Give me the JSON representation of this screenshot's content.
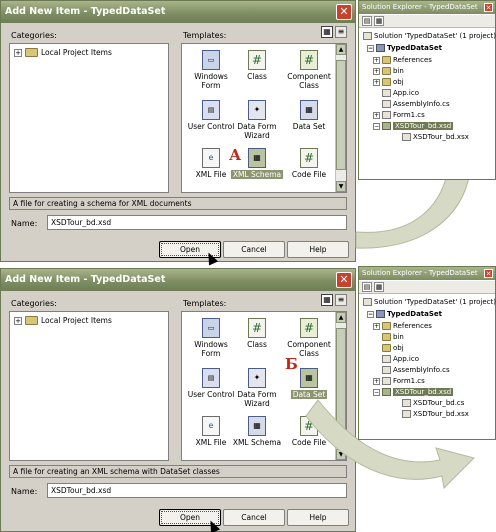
{
  "dialogs": [
    {
      "title": "Add New Item - TypedDataSet",
      "categories_label": "Categories:",
      "templates_label": "Templates:",
      "category_item": "Local Project Items",
      "templates": [
        {
          "label": "Windows Form",
          "icon": "windows-form-icon"
        },
        {
          "label": "Class",
          "icon": "class-icon"
        },
        {
          "label": "Component Class",
          "icon": "component-class-icon"
        },
        {
          "label": "User Control",
          "icon": "user-control-icon"
        },
        {
          "label": "Data Form Wizard",
          "icon": "data-form-wizard-icon"
        },
        {
          "label": "Data Set",
          "icon": "data-set-icon"
        },
        {
          "label": "XML File",
          "icon": "xml-file-icon"
        },
        {
          "label": "XML Schema",
          "icon": "xml-schema-icon"
        },
        {
          "label": "Code File",
          "icon": "code-file-icon"
        }
      ],
      "selected_template": "XML Schema",
      "marker": "А",
      "description": "A file for creating a schema for XML documents",
      "name_label": "Name:",
      "name_value": "XSDTour_bd.xsd",
      "open_label": "Open",
      "cancel_label": "Cancel",
      "help_label": "Help"
    },
    {
      "title": "Add New Item - TypedDataSet",
      "categories_label": "Categories:",
      "templates_label": "Templates:",
      "category_item": "Local Project Items",
      "templates": [
        {
          "label": "Windows Form",
          "icon": "windows-form-icon"
        },
        {
          "label": "Class",
          "icon": "class-icon"
        },
        {
          "label": "Component Class",
          "icon": "component-class-icon"
        },
        {
          "label": "User Control",
          "icon": "user-control-icon"
        },
        {
          "label": "Data Form Wizard",
          "icon": "data-form-wizard-icon"
        },
        {
          "label": "Data Set",
          "icon": "data-set-icon"
        },
        {
          "label": "XML File",
          "icon": "xml-file-icon"
        },
        {
          "label": "XML Schema",
          "icon": "xml-schema-icon"
        },
        {
          "label": "Code File",
          "icon": "code-file-icon"
        }
      ],
      "selected_template": "Data Set",
      "marker": "Б",
      "description": "A file for creating an XML schema with DataSet classes",
      "name_label": "Name:",
      "name_value": "XSDTour_bd.xsd",
      "open_label": "Open",
      "cancel_label": "Cancel",
      "help_label": "Help"
    }
  ],
  "explorers": [
    {
      "title": "Solution Explorer - TypedDataSet",
      "solution": "Solution 'TypedDataSet' (1 project)",
      "project": "TypedDataSet",
      "items": [
        {
          "label": "References",
          "kind": "folder",
          "expander": "+"
        },
        {
          "label": "bin",
          "kind": "folder",
          "expander": "+"
        },
        {
          "label": "obj",
          "kind": "folder",
          "expander": "+"
        },
        {
          "label": "App.ico",
          "kind": "file",
          "expander": ""
        },
        {
          "label": "AssemblyInfo.cs",
          "kind": "file",
          "expander": ""
        },
        {
          "label": "Form1.cs",
          "kind": "file",
          "expander": "+"
        },
        {
          "label": "XSDTour_bd.xsd",
          "kind": "xsd",
          "expander": "-",
          "selected": true
        },
        {
          "label": "XSDTour_bd.xsx",
          "kind": "file",
          "expander": "",
          "child": true
        }
      ]
    },
    {
      "title": "Solution Explorer - TypedDataSet",
      "solution": "Solution 'TypedDataSet' (1 project)",
      "project": "TypedDataSet",
      "items": [
        {
          "label": "References",
          "kind": "folder",
          "expander": "+"
        },
        {
          "label": "bin",
          "kind": "folder",
          "expander": ""
        },
        {
          "label": "obj",
          "kind": "folder",
          "expander": ""
        },
        {
          "label": "App.ico",
          "kind": "file",
          "expander": ""
        },
        {
          "label": "AssemblyInfo.cs",
          "kind": "file",
          "expander": ""
        },
        {
          "label": "Form1.cs",
          "kind": "file",
          "expander": "+"
        },
        {
          "label": "XSDTour_bd.xsd",
          "kind": "xsd",
          "expander": "-",
          "selected": true
        },
        {
          "label": "XSDTour_bd.cs",
          "kind": "file",
          "expander": "",
          "child": true
        },
        {
          "label": "XSDTour_bd.xsx",
          "kind": "file",
          "expander": "",
          "child": true
        }
      ]
    }
  ],
  "colors": {
    "titlebar": "#7f8e63",
    "selection": "#8b9670",
    "marker": "#c0281c",
    "arrow": "#d6dac4"
  }
}
